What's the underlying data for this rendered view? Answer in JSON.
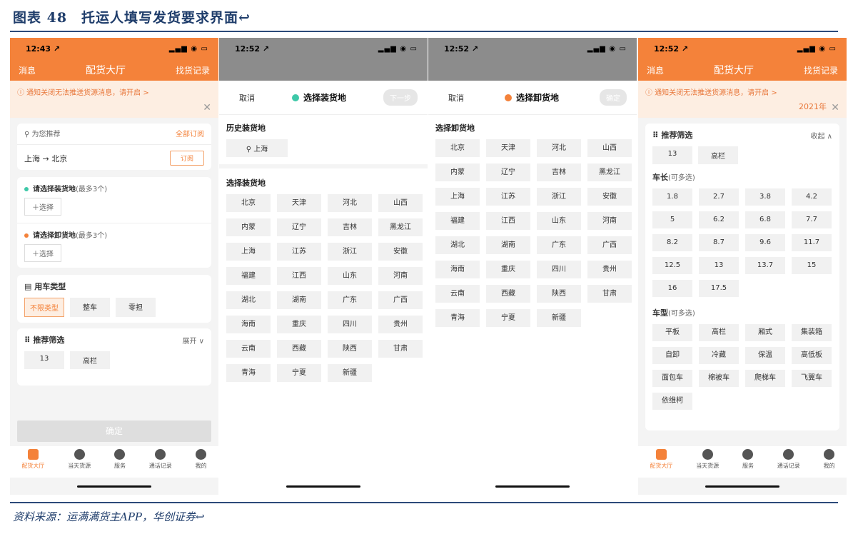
{
  "figure": {
    "title": "图表 48　托运人填写发货要求界面↩",
    "source": "资料来源：运满满货主APP，华创证券↩"
  },
  "common": {
    "time1": "12:43 ↗",
    "time2": "12:52 ↗",
    "status_icons": "▂▄▆ ◉ ▭",
    "cancel": "取消",
    "next": "下一步",
    "confirm_short": "确定"
  },
  "p1": {
    "left": "消息",
    "title": "配货大厅",
    "right": "找货记录",
    "notice": "ⓘ 通知关闭无法推送货源消息，请开启 >",
    "close": "✕",
    "rec_label": "⚲ 为您推荐",
    "rec_all": "全部订阅",
    "route": "上海 → 北京",
    "subscribe": "订阅",
    "load_label": "请选择装货地",
    "load_hint": "(最多3个)",
    "pick": "＋选择",
    "unload_label": "请选择卸货地",
    "unload_hint": "(最多3个)",
    "car_type_title": "▤ 用车类型",
    "car_types": [
      "不限类型",
      "整车",
      "零担"
    ],
    "filter_title": "⠿ 推荐筛选",
    "filter_expand": "展开 ∨",
    "filter_tags": [
      "13",
      "高栏"
    ],
    "confirm": "确定"
  },
  "p2": {
    "title": "选择装货地",
    "hist_label": "历史装货地",
    "hist_item": "⚲ 上海",
    "select_label": "选择装货地"
  },
  "p3": {
    "title": "选择卸货地",
    "select_label": "选择卸货地"
  },
  "provinces": [
    "北京",
    "天津",
    "河北",
    "山西",
    "内蒙",
    "辽宁",
    "吉林",
    "黑龙江",
    "上海",
    "江苏",
    "浙江",
    "安徽",
    "福建",
    "江西",
    "山东",
    "河南",
    "湖北",
    "湖南",
    "广东",
    "广西",
    "海南",
    "重庆",
    "四川",
    "贵州",
    "云南",
    "西藏",
    "陕西",
    "甘肃",
    "青海",
    "宁夏",
    "新疆"
  ],
  "p4": {
    "year": "2021年",
    "filter_title": "⠿ 推荐筛选",
    "collapse": "收起 ∧",
    "filter_tags": [
      "13",
      "高栏"
    ],
    "len_title": "车长",
    "len_hint": "(可多选)",
    "lengths": [
      "1.8",
      "2.7",
      "3.8",
      "4.2",
      "5",
      "6.2",
      "6.8",
      "7.7",
      "8.2",
      "8.7",
      "9.6",
      "11.7",
      "12.5",
      "13",
      "13.7",
      "15",
      "16",
      "17.5"
    ],
    "type_title": "车型",
    "type_hint": "(可多选)",
    "types": [
      "平板",
      "高栏",
      "厢式",
      "集装箱",
      "自卸",
      "冷藏",
      "保温",
      "高低板",
      "面包车",
      "棉被车",
      "爬梯车",
      "飞翼车",
      "依维柯"
    ]
  },
  "tabs": [
    "配货大厅",
    "当天货源",
    "服务",
    "通话记录",
    "我的"
  ],
  "colors": {
    "accent": "#f4823a",
    "green": "#3ec8a8"
  }
}
